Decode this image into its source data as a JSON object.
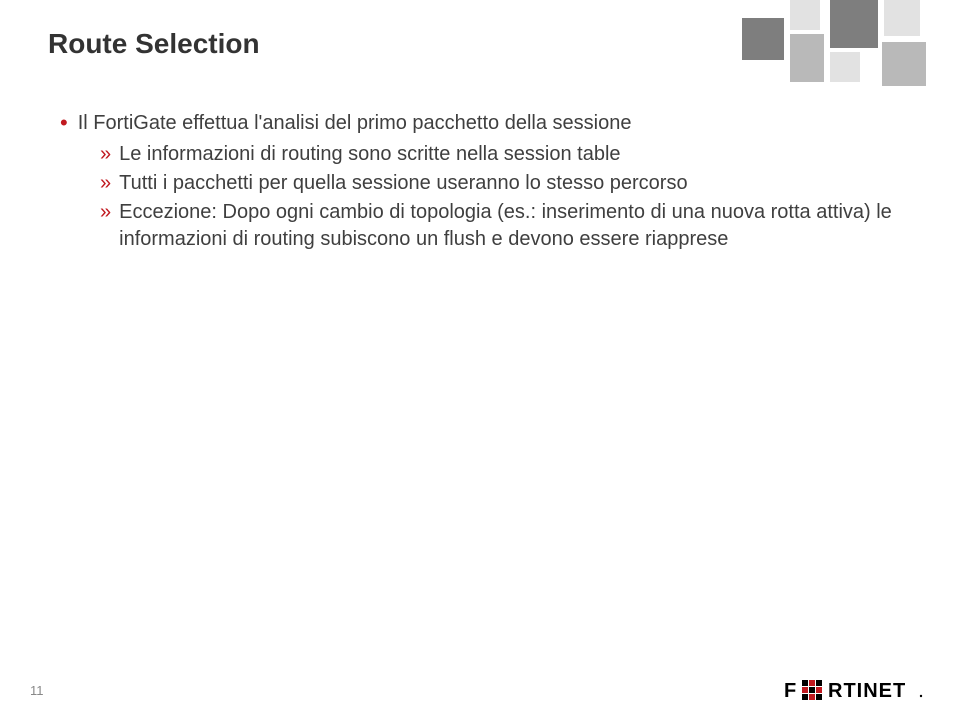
{
  "title": "Route Selection",
  "bullets": {
    "l1": "Il FortiGate effettua l'analisi del primo pacchetto della sessione",
    "l2a": "Le informazioni di routing sono scritte nella session table",
    "l2b": "Tutti i pacchetti per quella sessione useranno lo stesso percorso",
    "l2c": "Eccezione: Dopo ogni cambio di topologia (es.: inserimento di una nuova rotta attiva) le informazioni di routing subiscono un flush e devono essere riapprese"
  },
  "pageNumber": "11",
  "logoText": "F   RTINET",
  "deco": {
    "colors": {
      "dark": "#7e7e7e",
      "mid": "#b9b9b9",
      "light": "#e2e2e2"
    }
  }
}
